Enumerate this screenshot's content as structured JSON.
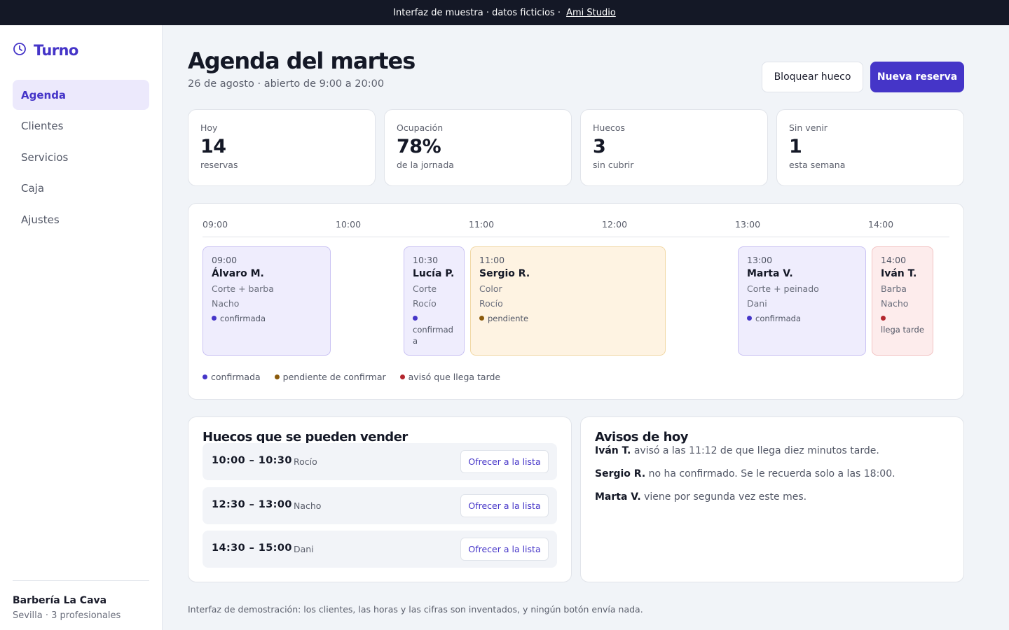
{
  "banner": {
    "text": "Interfaz de muestra · datos ficticios ·",
    "link": "Ami Studio"
  },
  "app": {
    "name": "Turno",
    "icon": "clock-icon",
    "accent": "#4535c8"
  },
  "nav": [
    {
      "label": "Agenda",
      "active": true
    },
    {
      "label": "Clientes",
      "active": false
    },
    {
      "label": "Servicios",
      "active": false
    },
    {
      "label": "Caja",
      "active": false
    },
    {
      "label": "Ajustes",
      "active": false
    }
  ],
  "business": {
    "name": "Barbería La Cava",
    "sub": "Sevilla · 3 profesionales"
  },
  "header": {
    "title": "Agenda del martes",
    "subtitle": "26 de agosto · abierto de 9:00 a 20:00",
    "block_button": "Bloquear hueco",
    "new_button": "Nueva reserva"
  },
  "stats": [
    {
      "label": "Hoy",
      "value": "14",
      "sub": "reservas"
    },
    {
      "label": "Ocupación",
      "value": "78%",
      "sub": "de la jornada"
    },
    {
      "label": "Huecos",
      "value": "3",
      "sub": "sin cubrir"
    },
    {
      "label": "Sin venir",
      "value": "1",
      "sub": "esta semana"
    }
  ],
  "timeline": {
    "ticks": [
      "09:00",
      "10:00",
      "11:00",
      "12:00",
      "13:00",
      "14:00"
    ],
    "appointments": [
      {
        "time": "09:00",
        "client": "Álvaro M.",
        "service": "Corte + barba",
        "professional": "Nacho",
        "status": "confirmada",
        "kind": "confirmed"
      },
      {
        "time": "10:30",
        "client": "Lucía P.",
        "service": "Corte",
        "professional": "Rocío",
        "status": "confirmada",
        "kind": "confirmed"
      },
      {
        "time": "11:00",
        "client": "Sergio R.",
        "service": "Color",
        "professional": "Rocío",
        "status": "pendiente",
        "kind": "pending"
      },
      {
        "time": "13:00",
        "client": "Marta V.",
        "service": "Corte + peinado",
        "professional": "Dani",
        "status": "confirmada",
        "kind": "confirmed"
      },
      {
        "time": "14:00",
        "client": "Iván T.",
        "service": "Barba",
        "professional": "Nacho",
        "status": "llega tarde",
        "kind": "late"
      }
    ],
    "legend": [
      {
        "label": "confirmada",
        "color": "#4535c8"
      },
      {
        "label": "pendiente de confirmar",
        "color": "#8a5a0b"
      },
      {
        "label": "avisó que llega tarde",
        "color": "#b3262d"
      }
    ]
  },
  "slots": {
    "title": "Huecos que se pueden vender",
    "button_label": "Ofrecer a la lista",
    "items": [
      {
        "time": "10:00 – 10:30",
        "professional": "Rocío"
      },
      {
        "time": "12:30 – 13:00",
        "professional": "Nacho"
      },
      {
        "time": "14:30 – 15:00",
        "professional": "Dani"
      }
    ]
  },
  "notices": {
    "title": "Avisos de hoy",
    "items": [
      {
        "name": "Iván T.",
        "text": "avisó a las 11:12 de que llega diez minutos tarde."
      },
      {
        "name": "Sergio R.",
        "text": "no ha confirmado. Se le recuerda solo a las 18:00."
      },
      {
        "name": "Marta V.",
        "text": "viene por segunda vez este mes."
      }
    ]
  },
  "footer_note": "Interfaz de demostración: los clientes, las horas y las cifras son inventados, y ningún botón envía nada."
}
